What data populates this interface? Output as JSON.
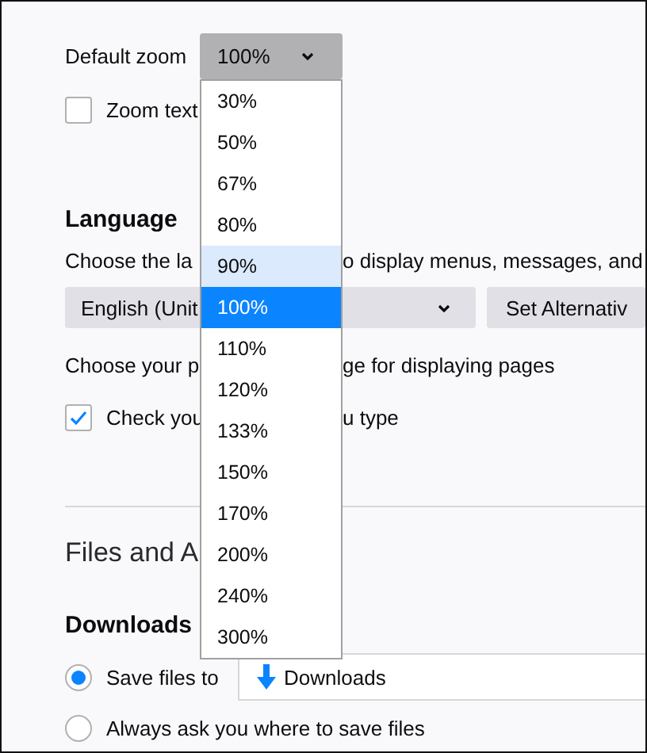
{
  "zoom": {
    "label": "Default zoom",
    "value": "100%",
    "zoom_text": {
      "label": "Zoom text",
      "checked": false
    },
    "options": [
      {
        "label": "30%",
        "highlighted": false,
        "selected": false
      },
      {
        "label": "50%",
        "highlighted": false,
        "selected": false
      },
      {
        "label": "67%",
        "highlighted": false,
        "selected": false
      },
      {
        "label": "80%",
        "highlighted": false,
        "selected": false
      },
      {
        "label": "90%",
        "highlighted": true,
        "selected": false
      },
      {
        "label": "100%",
        "highlighted": false,
        "selected": true
      },
      {
        "label": "110%",
        "highlighted": false,
        "selected": false
      },
      {
        "label": "120%",
        "highlighted": false,
        "selected": false
      },
      {
        "label": "133%",
        "highlighted": false,
        "selected": false
      },
      {
        "label": "150%",
        "highlighted": false,
        "selected": false
      },
      {
        "label": "170%",
        "highlighted": false,
        "selected": false
      },
      {
        "label": "200%",
        "highlighted": false,
        "selected": false
      },
      {
        "label": "240%",
        "highlighted": false,
        "selected": false
      },
      {
        "label": "300%",
        "highlighted": false,
        "selected": false
      }
    ]
  },
  "language": {
    "heading": "Language",
    "description": [
      "Choose the la",
      "o display menus, messages, and"
    ],
    "select": {
      "value": "English (Unit"
    },
    "button": "Set Alternativ",
    "page_language": [
      "Choose your p",
      "ge for displaying pages"
    ],
    "spell_check": {
      "parts": [
        "Check you",
        "u type"
      ],
      "checked": true
    }
  },
  "files": {
    "heading": "Files and A",
    "downloads": {
      "heading": "Downloads",
      "options": [
        {
          "kind": "save_to",
          "label": "Save files to",
          "selected": true,
          "folder": "Downloads"
        },
        {
          "kind": "ask",
          "label": "Always ask you where to save files",
          "selected": false
        }
      ]
    }
  }
}
